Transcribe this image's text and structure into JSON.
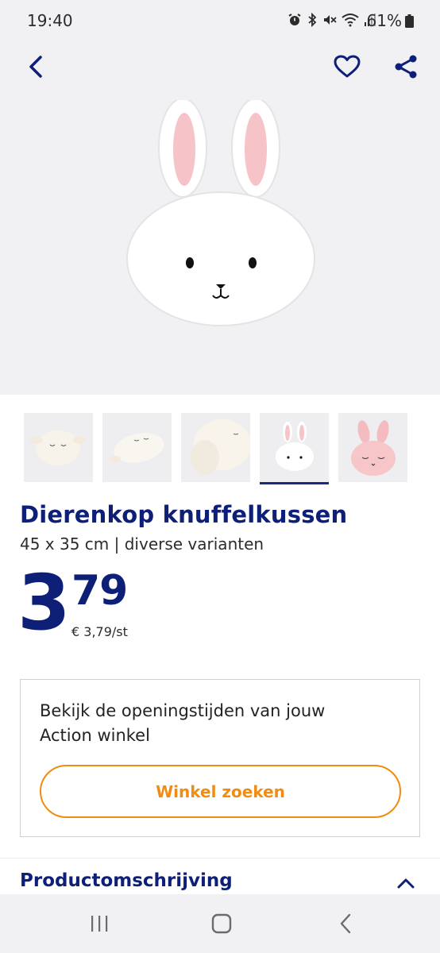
{
  "status_bar": {
    "time": "19:40",
    "battery": "61%",
    "icons": [
      "alarm-icon",
      "bluetooth-icon",
      "mute-icon",
      "wifi-icon",
      "signal-icon",
      "battery-icon"
    ]
  },
  "top_nav": {
    "icons": [
      "back-chevron-icon",
      "heart-icon",
      "share-icon"
    ]
  },
  "gallery": {
    "thumbnails": [
      {
        "icon": "lamb-pillow-thumbnail"
      },
      {
        "icon": "lamb-pillow-flat-thumbnail"
      },
      {
        "icon": "lamb-pillow-side-thumbnail"
      },
      {
        "icon": "bunny-pillow-white-thumbnail",
        "selected": true
      },
      {
        "icon": "bunny-pillow-pink-thumbnail"
      }
    ]
  },
  "product": {
    "title": "Dierenkop knuffelkussen",
    "subtitle": "45 x 35 cm | diverse varianten",
    "price_whole": "3",
    "price_cents": "79",
    "price_unit": "€ 3,79/st"
  },
  "store_box": {
    "text": "Bekijk de openingstijden van jouw Action winkel",
    "button_label": "Winkel zoeken"
  },
  "section": {
    "title": "Productomschrijving",
    "toggle_icon": "chevron-up-icon"
  },
  "system_nav": {
    "icons": [
      "recents-icon",
      "home-icon",
      "back-icon"
    ]
  },
  "colors": {
    "brand_blue": "#0d1f77",
    "accent_orange": "#f08c12",
    "background_grey": "#f1f1f4"
  }
}
